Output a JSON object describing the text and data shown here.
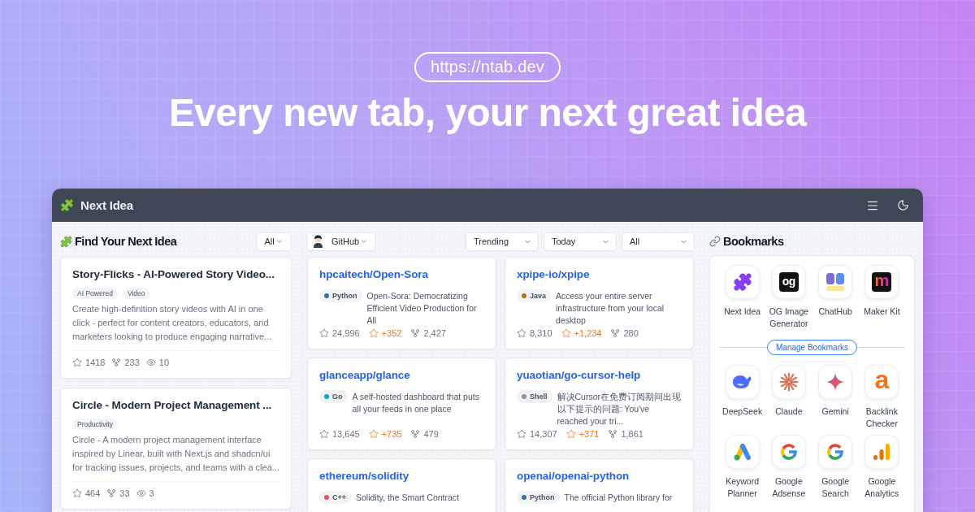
{
  "hero": {
    "url": "https://ntab.dev",
    "headline": "Every new tab, your next great idea"
  },
  "app": {
    "title": "Next Idea",
    "ideas": {
      "title": "Find Your Next Idea",
      "filter": "All",
      "cards": [
        {
          "title": "Story-Flicks - AI-Powered Story Video...",
          "tags": [
            "AI Powered",
            "Video"
          ],
          "description": "Create high-definition story videos with AI in one click - perfect for content creators, educators, and marketers looking to produce engaging narrative...",
          "star_count": "1418",
          "fork_count": "233",
          "view_count": "10"
        },
        {
          "title": "Circle - Modern Project Management ...",
          "tags": [
            "Productivity"
          ],
          "description": "Circle - A modern project management interface inspired by Linear, built with Next.js and shadcn/ui for tracking issues, projects, and teams with a clea...",
          "star_count": "464",
          "fork_count": "33",
          "view_count": "3"
        }
      ]
    },
    "repos": {
      "source": "GitHub",
      "filters": [
        "Trending",
        "Today",
        "All"
      ],
      "items": [
        {
          "name": "hpcaitech/Open-Sora",
          "language": "Python",
          "color": "#3572a5",
          "description": "Open-Sora: Democratizing Efficient Video Production for All",
          "star_count": "24,996",
          "today_stars": "+352",
          "fork_count": "2,427"
        },
        {
          "name": "xpipe-io/xpipe",
          "language": "Java",
          "color": "#b07219",
          "description": "Access your entire server infrastructure from your local desktop",
          "star_count": "8,310",
          "today_stars": "+1,234",
          "fork_count": "280"
        },
        {
          "name": "glanceapp/glance",
          "language": "Go",
          "color": "#00add8",
          "description": "A self-hosted dashboard that puts all your feeds in one place",
          "star_count": "13,645",
          "today_stars": "+735",
          "fork_count": "479"
        },
        {
          "name": "yuaotian/go-cursor-help",
          "language": "Shell",
          "color": "#8e9196",
          "description": "解决Cursor在免费订阅期间出现以下提示的问题: You've reached your tri...",
          "star_count": "14,307",
          "today_stars": "+371",
          "fork_count": "1,861"
        },
        {
          "name": "ethereum/solidity",
          "language": "C++",
          "color": "#e5535d",
          "description": "Solidity, the Smart Contract"
        },
        {
          "name": "openai/openai-python",
          "language": "Python",
          "color": "#3572a5",
          "description": "The official Python library for"
        }
      ]
    },
    "bookmarks": {
      "title": "Bookmarks",
      "pinned": [
        {
          "label": "Next Idea",
          "kind": "puzzle"
        },
        {
          "label": "OG Image Generator",
          "kind": "og",
          "logo_text": "og"
        },
        {
          "label": "ChatHub",
          "kind": "chathub"
        },
        {
          "label": "Maker Kit",
          "kind": "makerkit",
          "logo_text": "m"
        }
      ],
      "manage_label": "Manage Bookmarks",
      "items": [
        {
          "label": "DeepSeek",
          "kind": "whale"
        },
        {
          "label": "Claude",
          "kind": "starburst"
        },
        {
          "label": "Gemini",
          "kind": "sparkle"
        },
        {
          "label": "Backlink Checker",
          "kind": "letter",
          "logo_text": "a"
        },
        {
          "label": "Keyword Planner",
          "kind": "ads"
        },
        {
          "label": "Google Adsense",
          "kind": "google"
        },
        {
          "label": "Google Search",
          "kind": "google"
        },
        {
          "label": "Google Analytics",
          "kind": "analytics"
        }
      ]
    }
  }
}
